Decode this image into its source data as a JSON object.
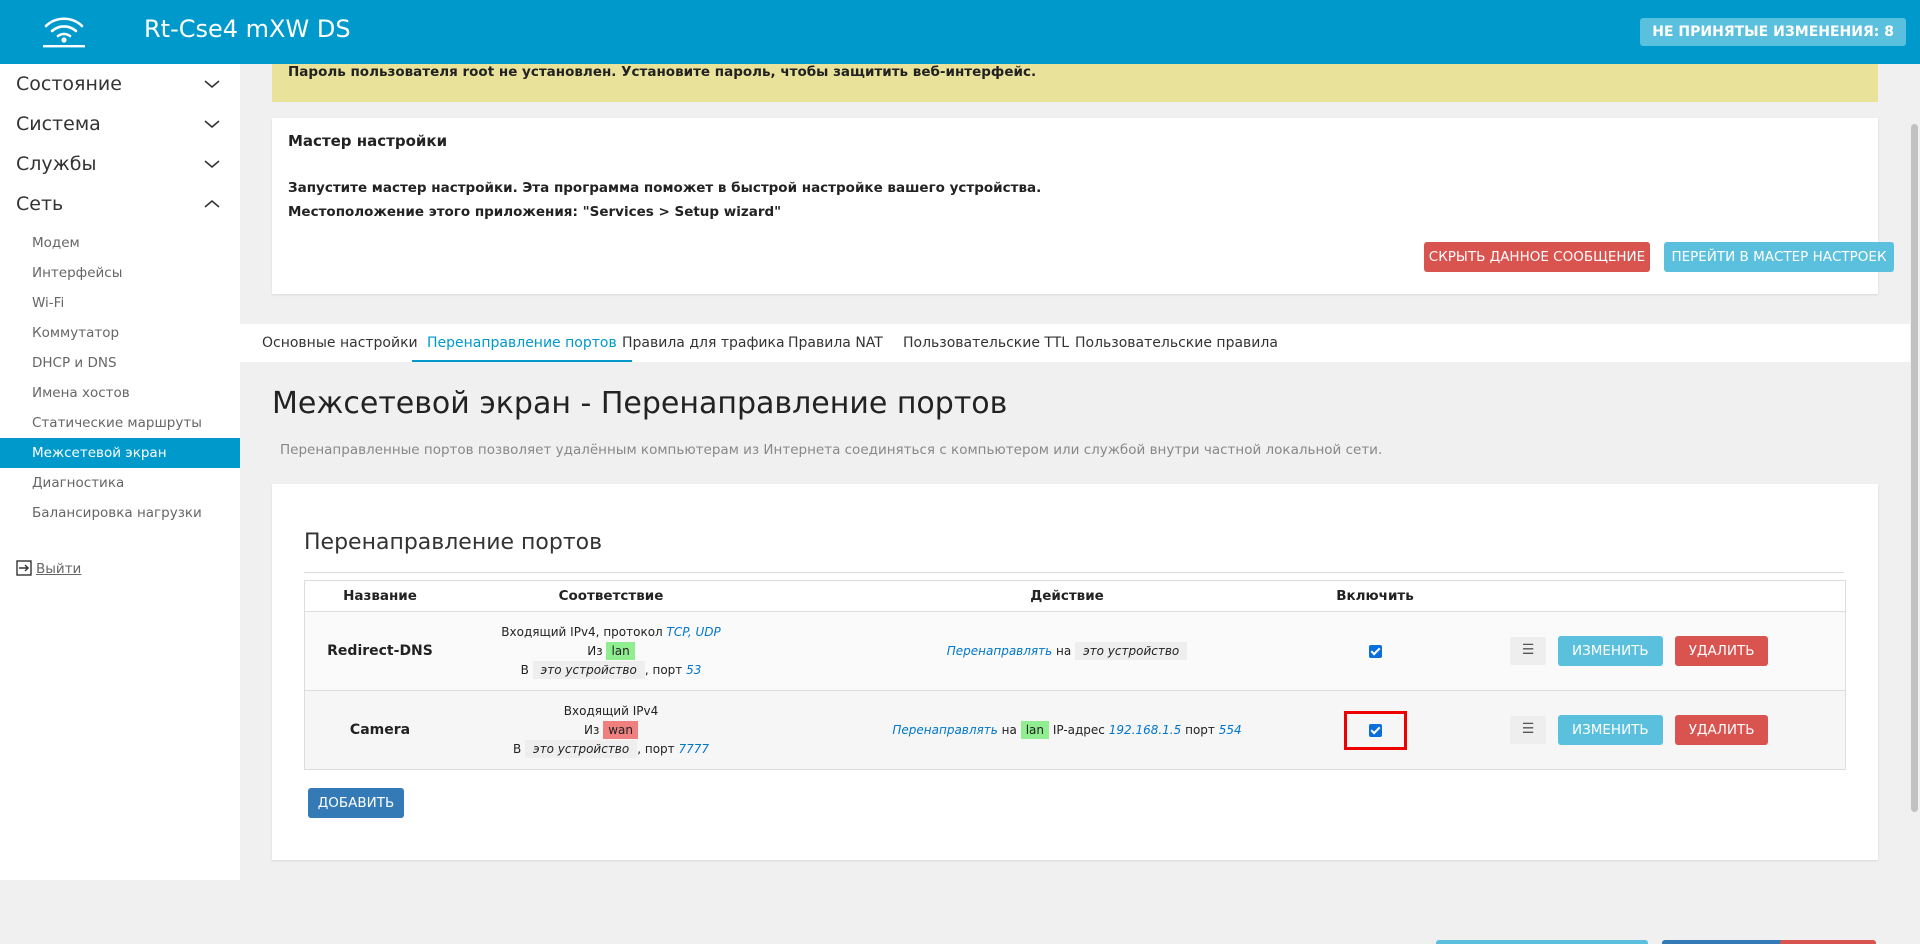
{
  "header": {
    "brand": "Rt-Cse4 mXW DS",
    "changes": "НЕ ПРИНЯТЫЕ ИЗМЕНЕНИЯ: 8",
    "logo_icon": "wifi-logo-icon"
  },
  "sidebar": {
    "menus": [
      {
        "label": "Состояние",
        "expanded": false
      },
      {
        "label": "Система",
        "expanded": false
      },
      {
        "label": "Службы",
        "expanded": false
      },
      {
        "label": "Сеть",
        "expanded": true
      }
    ],
    "network_items": [
      "Модем",
      "Интерфейсы",
      "Wi-Fi",
      "Коммутатор",
      "DHCP и DNS",
      "Имена хостов",
      "Статические маршруты",
      "Межсетевой экран",
      "Диагностика",
      "Балансировка нагрузки"
    ],
    "active_item": "Межсетевой экран",
    "logout": "Выйти"
  },
  "alert": {
    "text": "Пароль пользователя root не установлен. Установите пароль, чтобы защитить веб-интерфейс."
  },
  "wizard": {
    "title": "Мастер настройки",
    "line1": "Запустите мастер настройки. Эта программа поможет в быстрой настройке вашего устройства.",
    "line2": "Местоположение этого приложения: \"Services > Setup wizard\"",
    "hide_button": "СКРЫТЬ ДАННОЕ СООБЩЕНИЕ",
    "go_button": "ПЕРЕЙТИ В МАСТЕР НАСТРОЕК"
  },
  "tabs": [
    "Основные настройки",
    "Перенаправление портов",
    "Правила для трафика",
    "Правила NAT",
    "Пользовательские TTL",
    "Пользовательские правила"
  ],
  "active_tab": "Перенаправление портов",
  "page": {
    "title": "Межсетевой экран - Перенаправление портов",
    "description": "Перенаправленные портов позволяет удалённым компьютерам из Интернета соединяться с компьютером или службой внутри частной локальной сети."
  },
  "section": {
    "title": "Перенаправление портов",
    "columns": {
      "name": "Название",
      "match": "Соответствие",
      "action": "Действие",
      "enable": "Включить"
    },
    "rows": [
      {
        "name": "Redirect-DNS",
        "match_l1_prefix": "Входящий IPv4, протокол",
        "match_l1_proto": "TCP, UDP",
        "from_label": "Из",
        "from_zone": "lan",
        "to_label": "В",
        "to_dest": "это устройство",
        "port_label": ", порт",
        "port": "53",
        "action_verb": "Перенаправлять",
        "action_on": "на",
        "action_target": "это устройство",
        "enabled": true
      },
      {
        "name": "Camera",
        "match_l1_prefix": "Входящий IPv4",
        "from_label": "Из",
        "from_zone": "wan",
        "to_label": "В",
        "to_dest": "это устройство",
        "port_label": ", порт",
        "port": "7777",
        "action_verb": "Перенаправлять",
        "action_on": "на",
        "action_zone": "lan",
        "action_ip_label": "IP-адрес",
        "action_ip": "192.168.1.5",
        "action_port_label": "порт",
        "action_port": "554",
        "enabled": true
      }
    ],
    "drag_glyph": "☰",
    "edit_button": "ИЗМЕНИТЬ",
    "delete_button": "УДАЛИТЬ",
    "add_button": "ДОБАВИТЬ"
  },
  "colors": {
    "accent": "#0099cc",
    "alert_bg": "#e8e29a",
    "danger": "#d9534f",
    "info": "#5bc0de",
    "primary": "#337ab7",
    "zone_lan": "#90ee90",
    "zone_wan": "#f08080",
    "highlight": "#ee0000"
  }
}
